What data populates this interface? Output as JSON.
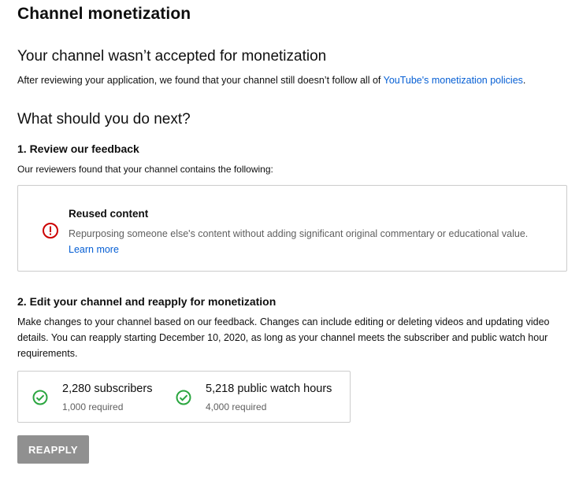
{
  "page_title": "Channel monetization",
  "status": {
    "heading": "Your channel wasn’t accepted for monetization",
    "body_prefix": "After reviewing your application, we found that your channel still doesn’t follow all of ",
    "policy_link": "YouTube's monetization policies",
    "body_suffix": "."
  },
  "next": {
    "heading": "What should you do next?",
    "step1": {
      "title": "1. Review our feedback",
      "intro": "Our reviewers found that your channel contains the following:",
      "issue": {
        "icon": "error-circle-icon",
        "title": "Reused content",
        "description": "Repurposing someone else's content without adding significant original commentary or educational value.",
        "link": "Learn more"
      }
    },
    "step2": {
      "title": "2. Edit your channel and reapply for monetization",
      "body": "Make changes to your channel based on our feedback. Changes can include editing or deleting videos and updating video details. You can reapply starting December 10, 2020, as long as your channel meets the subscriber and public watch hour requirements.",
      "requirements": [
        {
          "icon": "check-circle-icon",
          "value": "2,280 subscribers",
          "required": "1,000 required"
        },
        {
          "icon": "check-circle-icon",
          "value": "5,218 public watch hours",
          "required": "4,000 required"
        }
      ]
    }
  },
  "reapply_label": "REAPPLY",
  "colors": {
    "link": "#065fd4",
    "error": "#cc0000",
    "success": "#2ba640",
    "button_disabled": "#909090",
    "border": "#cccccc"
  }
}
